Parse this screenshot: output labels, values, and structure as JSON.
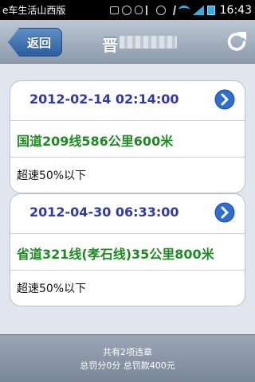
{
  "status_bar": {
    "app_name": "e车生活山西版",
    "time": "16:43",
    "icons": [
      "usb-icon",
      "smile-icon",
      "bug-icon",
      "usb-debug-icon",
      "alarm-icon",
      "bluetooth-icon",
      "wifi-icon",
      "signal-icon",
      "battery-icon"
    ]
  },
  "nav": {
    "back_label": "返回",
    "title": "晋",
    "refresh_icon": "refresh-icon"
  },
  "records": [
    {
      "datetime": "2012-02-14 02:14:00",
      "location": "国道209线586公里600米",
      "description": "超速50%以下"
    },
    {
      "datetime": "2012-04-30 06:33:00",
      "location": "省道321线(孝石线)35公里800米",
      "description": "超速50%以下"
    }
  ],
  "footer": {
    "summary": "共有2项违章",
    "totals": "总罚分0分 总罚款400元"
  },
  "colors": {
    "accent": "#2f3aa6",
    "location_green": "#1c8c22",
    "nav_button": "#3a6eb0"
  }
}
